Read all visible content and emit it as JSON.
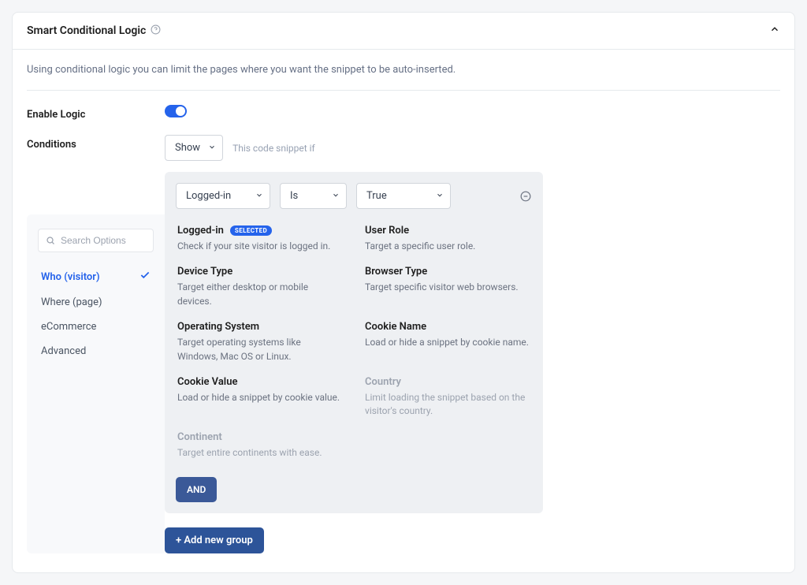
{
  "header": {
    "title": "Smart Conditional Logic"
  },
  "description": "Using conditional logic you can limit the pages where you want the snippet to be auto-inserted.",
  "enable": {
    "label": "Enable Logic"
  },
  "conditions": {
    "label": "Conditions",
    "visibility_select": "Show",
    "hint": "This code snippet if"
  },
  "rule": {
    "field": "Logged-in",
    "operator": "Is",
    "value": "True"
  },
  "search": {
    "placeholder": "Search Options"
  },
  "categories": [
    {
      "label": "Who (visitor)",
      "active": true
    },
    {
      "label": "Where (page)",
      "active": false
    },
    {
      "label": "eCommerce",
      "active": false
    },
    {
      "label": "Advanced",
      "active": false
    }
  ],
  "options": [
    {
      "title": "Logged-in",
      "desc": "Check if your site visitor is logged in.",
      "selected": true,
      "disabled": false
    },
    {
      "title": "User Role",
      "desc": "Target a specific user role.",
      "selected": false,
      "disabled": false
    },
    {
      "title": "Device Type",
      "desc": "Target either desktop or mobile devices.",
      "selected": false,
      "disabled": false
    },
    {
      "title": "Browser Type",
      "desc": "Target specific visitor web browsers.",
      "selected": false,
      "disabled": false
    },
    {
      "title": "Operating System",
      "desc": "Target operating systems like Windows, Mac OS or Linux.",
      "selected": false,
      "disabled": false
    },
    {
      "title": "Cookie Name",
      "desc": "Load or hide a snippet by cookie name.",
      "selected": false,
      "disabled": false
    },
    {
      "title": "Cookie Value",
      "desc": "Load or hide a snippet by cookie value.",
      "selected": false,
      "disabled": false
    },
    {
      "title": "Country",
      "desc": "Limit loading the snippet based on the visitor's country.",
      "selected": false,
      "disabled": true
    },
    {
      "title": "Continent",
      "desc": "Target entire continents with ease.",
      "selected": false,
      "disabled": true
    }
  ],
  "badge_label": "SELECTED",
  "buttons": {
    "and": "AND",
    "add_group": "+ Add new group"
  }
}
